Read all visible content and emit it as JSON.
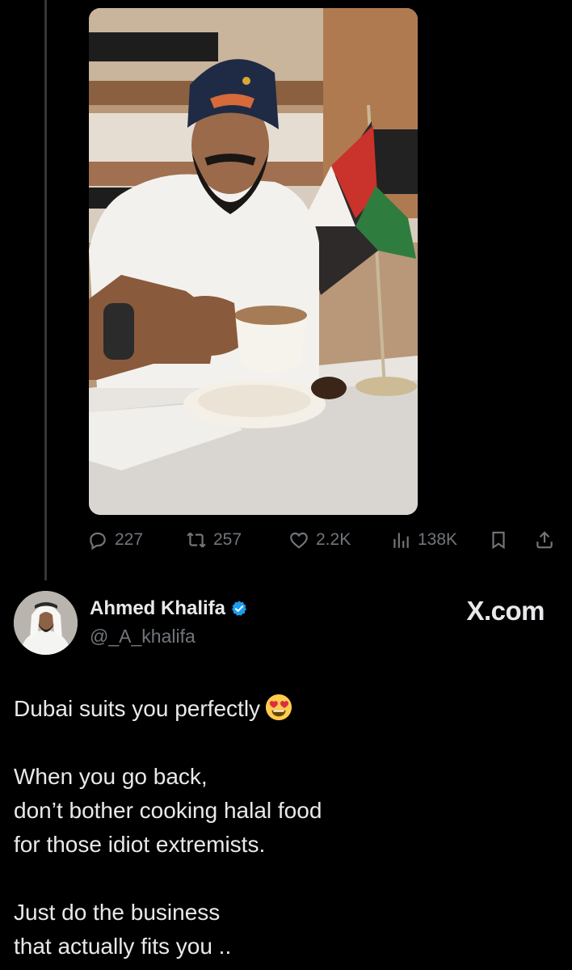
{
  "quoted_tweet": {
    "stats": {
      "replies": "227",
      "retweets": "257",
      "likes": "2.2K",
      "views": "138K"
    }
  },
  "author": {
    "name": "Ahmed Khalifa",
    "handle": "@_A_khalifa",
    "verified": true
  },
  "brand": "X.com",
  "tweet": {
    "paragraphs": [
      [
        "Dubai suits you perfectly"
      ],
      [
        "When you go back,",
        "don’t bother cooking halal food",
        "for those idiot extremists."
      ],
      [
        "Just do the business",
        "that actually fits you .."
      ]
    ],
    "emoji": "smiling-face-with-heart-eyes"
  },
  "colors": {
    "background": "#000000",
    "text": "#e7e9ea",
    "muted": "#71767b",
    "verified": "#1d9bf0"
  }
}
